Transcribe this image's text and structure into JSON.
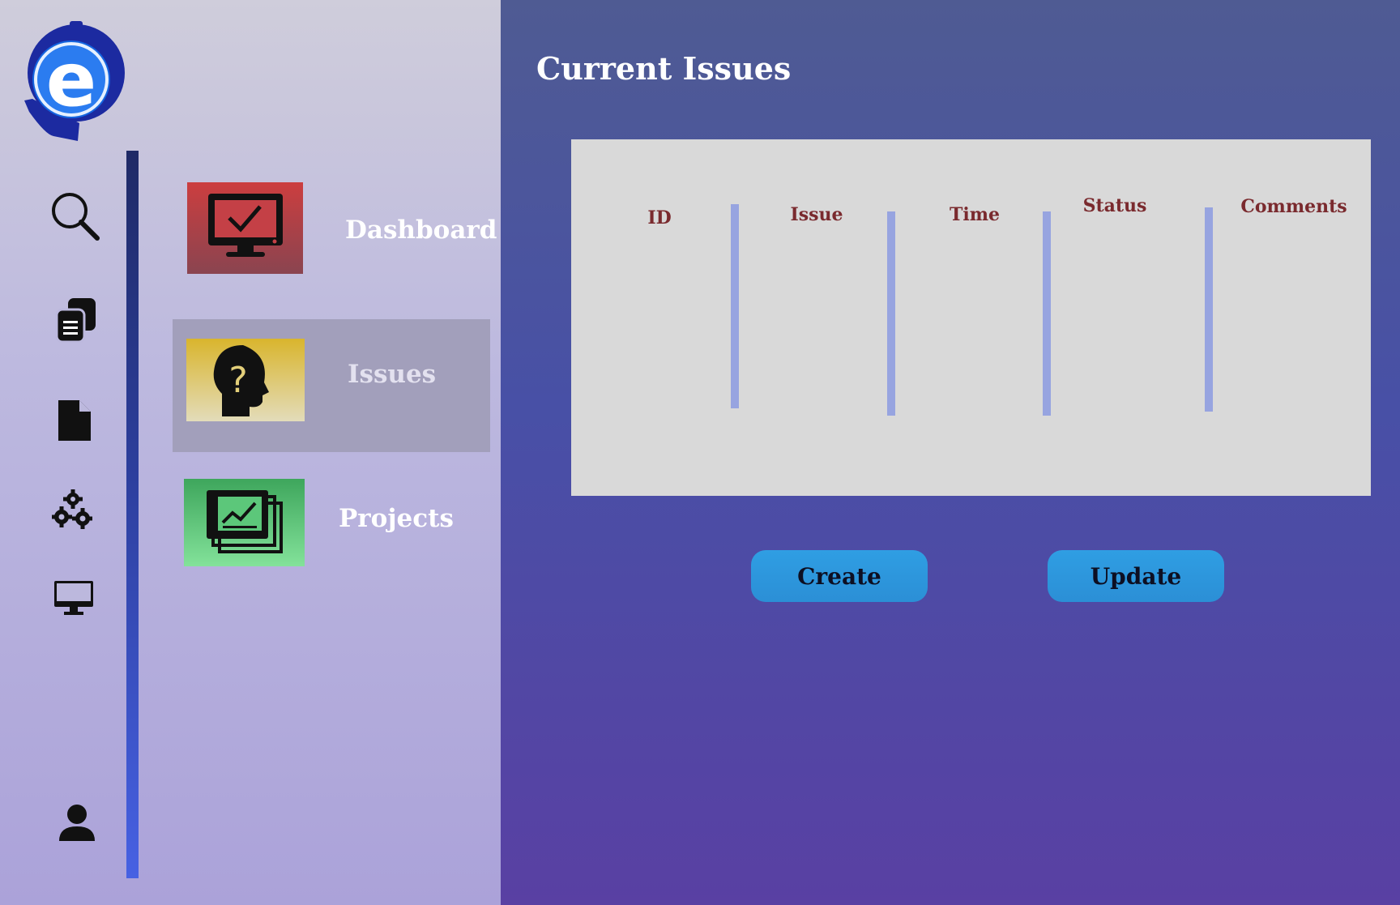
{
  "sidebar": {
    "logo": {
      "letter": "e",
      "icon": "headset-e-logo"
    },
    "rail_icons": [
      {
        "name": "search-icon"
      },
      {
        "name": "copy-documents-icon"
      },
      {
        "name": "file-icon"
      },
      {
        "name": "gears-icon"
      },
      {
        "name": "monitor-icon"
      },
      {
        "name": "user-icon"
      }
    ],
    "nav": [
      {
        "label": "Dashboard",
        "icon": "monitor-check-icon",
        "active": false
      },
      {
        "label": "Issues",
        "icon": "head-question-icon",
        "active": true
      },
      {
        "label": "Projects",
        "icon": "chart-stack-icon",
        "active": false
      }
    ],
    "thumb_colors": {
      "dashboard": [
        "#cc3e3f",
        "#8a4450"
      ],
      "issues": [
        "#d9b52d",
        "#e3dcba"
      ],
      "projects": [
        "#3ea65c",
        "#83e29a"
      ]
    }
  },
  "main": {
    "title": "Current Issues",
    "table": {
      "columns": [
        "ID",
        "Issue",
        "Time",
        "Status",
        "Comments"
      ],
      "rows": []
    },
    "buttons": {
      "create": "Create",
      "update": "Update"
    }
  },
  "colors": {
    "header_text": "#7a2a2e",
    "separator": "#97a4e0",
    "button": "#2b8fd6",
    "table_bg": "#d9d9d9"
  }
}
